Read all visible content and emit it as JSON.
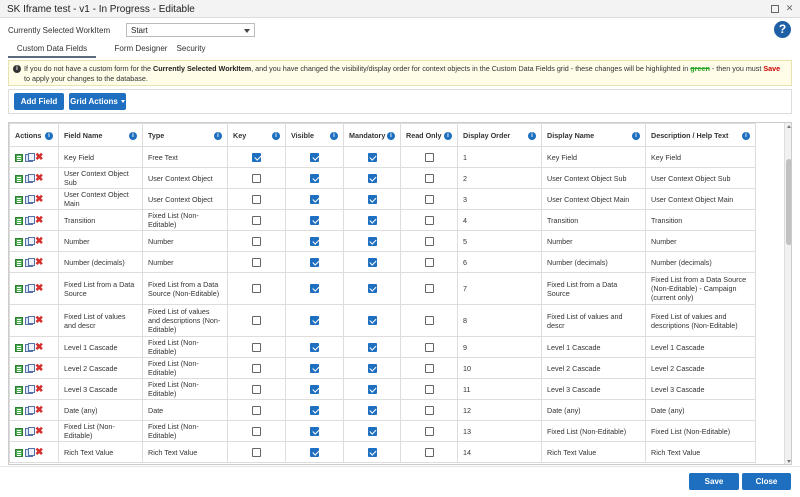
{
  "window": {
    "title": "SK Iframe test - v1 - In Progress - Editable"
  },
  "workitem": {
    "label": "Currently Selected WorkItem",
    "value": "Start"
  },
  "help": {
    "glyph": "?"
  },
  "tabs": [
    {
      "label": "Custom Data Fields",
      "active": true
    },
    {
      "label": "Form Designer",
      "active": false
    },
    {
      "label": "Security",
      "active": false
    }
  ],
  "notice": {
    "part1": "If you do not have a custom form for the ",
    "bold1": "Currently Selected WorkItem",
    "part2": ", and you have changed the visibility/display order for context objects in the Custom Data Fields grid - these changes will be highlighted in ",
    "green": "green",
    "part3": " - then you must ",
    "save": "Save",
    "part4": " to apply your changes to the database."
  },
  "toolbar": {
    "add_field": "Add Field",
    "grid_actions": "Grid Actions"
  },
  "columns": [
    "Actions",
    "Field Name",
    "Type",
    "Key",
    "Visible",
    "Mandatory",
    "Read Only",
    "Display Order",
    "Display Name",
    "Description / Help Text"
  ],
  "rows": [
    {
      "field": "Key Field",
      "type": "Free Text",
      "key": true,
      "visible": true,
      "mandatory": true,
      "readonly": false,
      "order": "1",
      "display": "Key Field",
      "desc": "Key Field"
    },
    {
      "field": "User Context Object Sub",
      "type": "User Context Object",
      "key": false,
      "visible": true,
      "mandatory": true,
      "readonly": false,
      "order": "2",
      "display": "User Context Object Sub",
      "desc": "User Context Object Sub"
    },
    {
      "field": "User Context Object Main",
      "type": "User Context Object",
      "key": false,
      "visible": true,
      "mandatory": true,
      "readonly": false,
      "order": "3",
      "display": "User Context Object Main",
      "desc": "User Context Object Main"
    },
    {
      "field": "Transition",
      "type": "Fixed List (Non-Editable)",
      "key": false,
      "visible": true,
      "mandatory": true,
      "readonly": false,
      "order": "4",
      "display": "Transition",
      "desc": "Transition"
    },
    {
      "field": "Number",
      "type": "Number",
      "key": false,
      "visible": true,
      "mandatory": true,
      "readonly": false,
      "order": "5",
      "display": "Number",
      "desc": "Number"
    },
    {
      "field": "Number (decimals)",
      "type": "Number",
      "key": false,
      "visible": true,
      "mandatory": true,
      "readonly": false,
      "order": "6",
      "display": "Number (decimals)",
      "desc": "Number (decimals)"
    },
    {
      "field": "Fixed List from a Data Source",
      "type": "Fixed List from a Data Source (Non-Editable)",
      "key": false,
      "visible": true,
      "mandatory": true,
      "readonly": false,
      "order": "7",
      "display": "Fixed List from a Data Source",
      "desc": "Fixed List from a Data Source (Non-Editable) - Campaign (current only)",
      "tall": true
    },
    {
      "field": "Fixed List of values and descr",
      "type": "Fixed List of values and descriptions (Non-Editable)",
      "key": false,
      "visible": true,
      "mandatory": true,
      "readonly": false,
      "order": "8",
      "display": "Fixed List of values and descr",
      "desc": "Fixed List of values and descriptions (Non-Editable)",
      "tall": true
    },
    {
      "field": "Level 1 Cascade",
      "type": "Fixed List (Non-Editable)",
      "key": false,
      "visible": true,
      "mandatory": true,
      "readonly": false,
      "order": "9",
      "display": "Level 1 Cascade",
      "desc": "Level 1 Cascade"
    },
    {
      "field": "Level 2 Cascade",
      "type": "Fixed List (Non-Editable)",
      "key": false,
      "visible": true,
      "mandatory": true,
      "readonly": false,
      "order": "10",
      "display": "Level 2 Cascade",
      "desc": "Level 2 Cascade"
    },
    {
      "field": "Level 3 Cascade",
      "type": "Fixed List (Non-Editable)",
      "key": false,
      "visible": true,
      "mandatory": true,
      "readonly": false,
      "order": "11",
      "display": "Level 3 Cascade",
      "desc": "Level 3 Cascade"
    },
    {
      "field": "Date (any)",
      "type": "Date",
      "key": false,
      "visible": true,
      "mandatory": true,
      "readonly": false,
      "order": "12",
      "display": "Date (any)",
      "desc": "Date (any)"
    },
    {
      "field": "Fixed List (Non-Editable)",
      "type": "Fixed List (Non-Editable)",
      "key": false,
      "visible": true,
      "mandatory": true,
      "readonly": false,
      "order": "13",
      "display": "Fixed List (Non-Editable)",
      "desc": "Fixed List (Non-Editable)"
    },
    {
      "field": "Rich Text Value",
      "type": "Rich Text Value",
      "key": false,
      "visible": true,
      "mandatory": true,
      "readonly": false,
      "order": "14",
      "display": "Rich Text Value",
      "desc": "Rich Text Value"
    }
  ],
  "footer": {
    "save": "Save",
    "close": "Close"
  }
}
